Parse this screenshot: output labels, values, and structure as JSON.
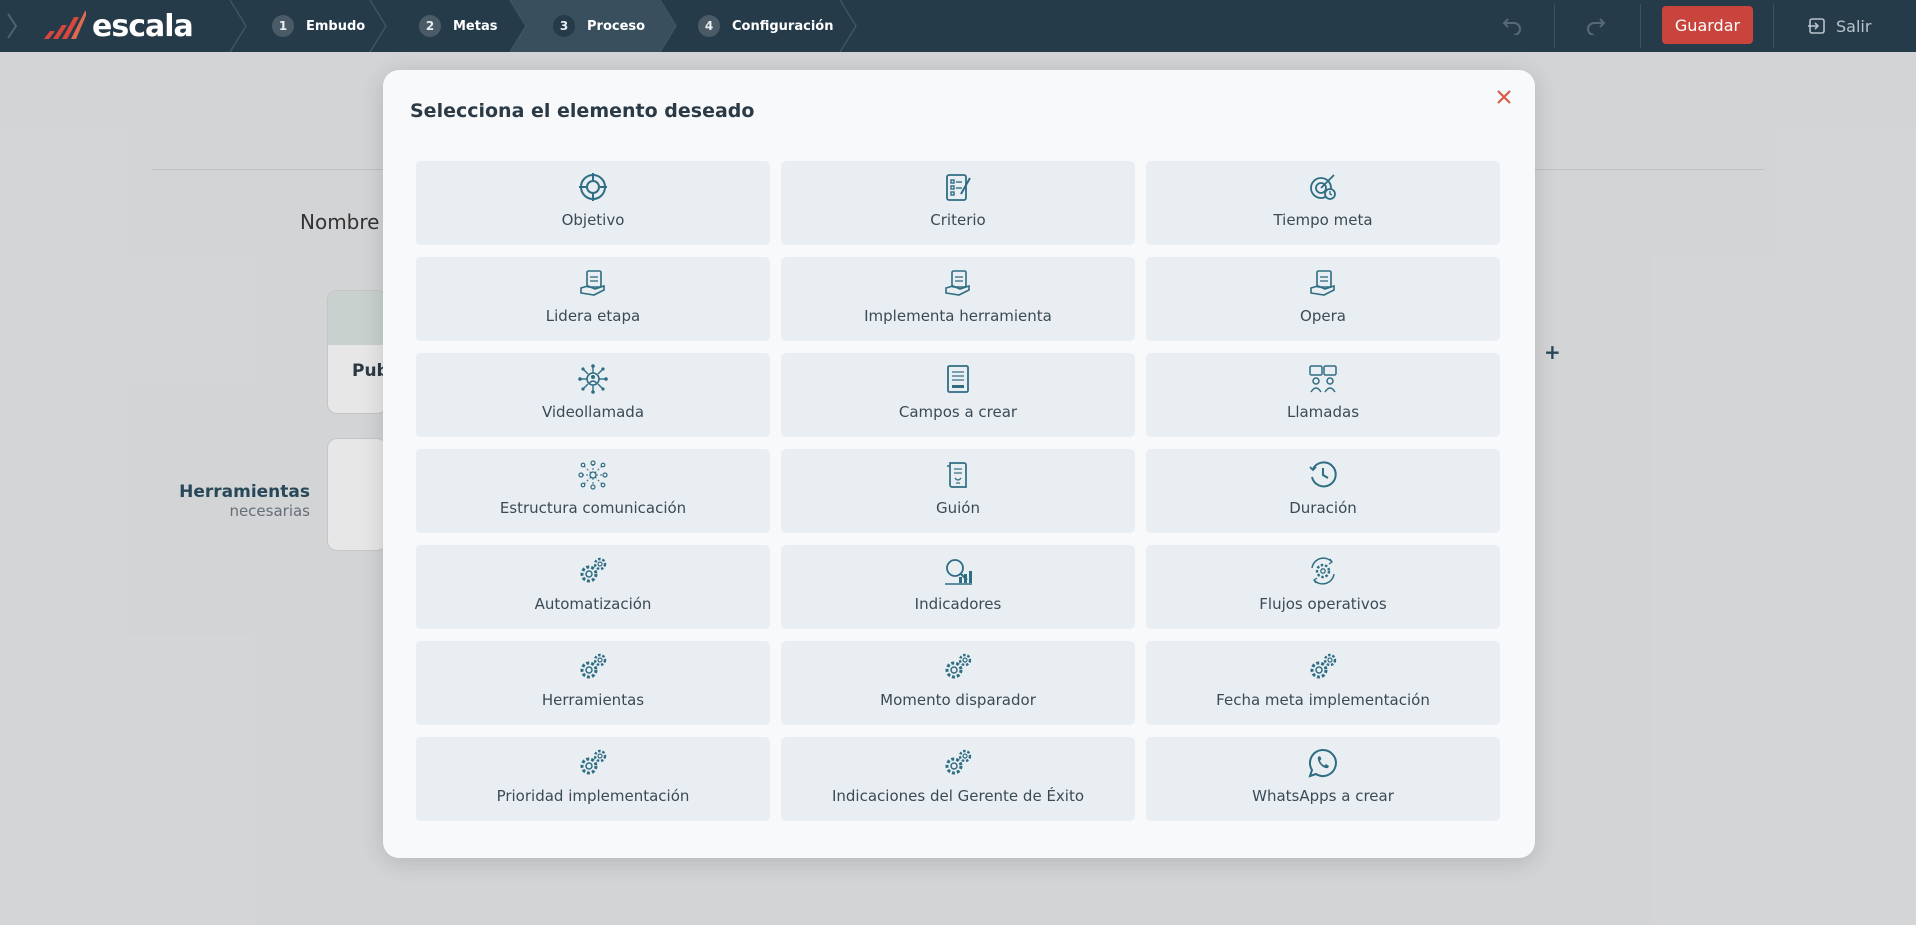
{
  "brand": {
    "name": "escala"
  },
  "steps": [
    {
      "num": "1",
      "label": "Embudo"
    },
    {
      "num": "2",
      "label": "Metas"
    },
    {
      "num": "3",
      "label": "Proceso"
    },
    {
      "num": "4",
      "label": "Configuración"
    }
  ],
  "toolbar": {
    "save_label": "Guardar",
    "exit_label": "Salir"
  },
  "background": {
    "name_label": "Nombre d",
    "card_label": "Pub",
    "tools_title": "Herramientas",
    "tools_subtitle": "necesarias",
    "plus": "+"
  },
  "modal": {
    "title": "Selecciona el elemento deseado",
    "items": [
      {
        "label": "Objetivo",
        "icon": "target-icon"
      },
      {
        "label": "Criterio",
        "icon": "checklist-icon"
      },
      {
        "label": "Tiempo meta",
        "icon": "target-clock-icon"
      },
      {
        "label": "Lidera etapa",
        "icon": "hand-clipboard-icon"
      },
      {
        "label": "Implementa herramienta",
        "icon": "hand-clipboard-icon"
      },
      {
        "label": "Opera",
        "icon": "hand-clipboard-icon"
      },
      {
        "label": "Videollamada",
        "icon": "network-person-icon"
      },
      {
        "label": "Campos a crear",
        "icon": "form-icon"
      },
      {
        "label": "Llamadas",
        "icon": "people-chat-icon"
      },
      {
        "label": "Estructura comunicación",
        "icon": "network-nodes-icon"
      },
      {
        "label": "Guión",
        "icon": "script-icon"
      },
      {
        "label": "Duración",
        "icon": "clock-icon"
      },
      {
        "label": "Automatización",
        "icon": "gears-icon"
      },
      {
        "label": "Indicadores",
        "icon": "magnifier-chart-icon"
      },
      {
        "label": "Flujos operativos",
        "icon": "gear-cycle-icon"
      },
      {
        "label": "Herramientas",
        "icon": "gears-icon"
      },
      {
        "label": "Momento disparador",
        "icon": "gears-icon"
      },
      {
        "label": "Fecha meta implementación",
        "icon": "gears-icon"
      },
      {
        "label": "Prioridad implementación",
        "icon": "gears-icon"
      },
      {
        "label": "Indicaciones del Gerente de Éxito",
        "icon": "gears-icon"
      },
      {
        "label": "WhatsApps a crear",
        "icon": "whatsapp-icon"
      }
    ]
  },
  "colors": {
    "topbar": "#263b4a",
    "accent": "#c9443d",
    "icon": "#2f6d82"
  }
}
